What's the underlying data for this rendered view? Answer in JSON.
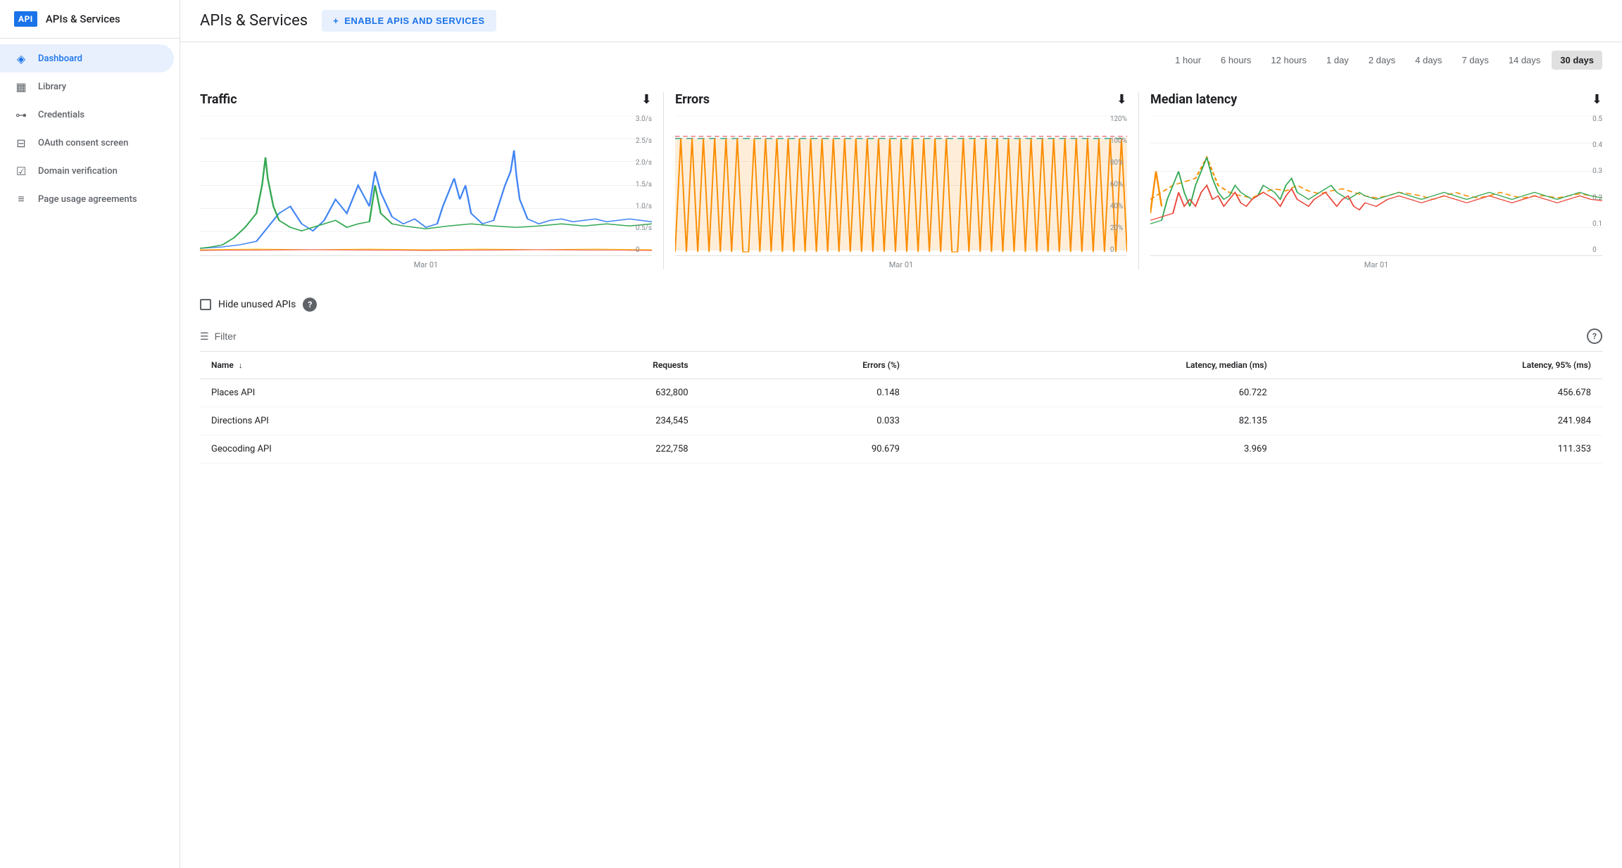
{
  "sidebar": {
    "logo_text": "API",
    "title": "APIs & Services",
    "items": [
      {
        "id": "dashboard",
        "label": "Dashboard",
        "icon": "◈",
        "active": true
      },
      {
        "id": "library",
        "label": "Library",
        "icon": "▦",
        "active": false
      },
      {
        "id": "credentials",
        "label": "Credentials",
        "icon": "⊶",
        "active": false
      },
      {
        "id": "oauth",
        "label": "OAuth consent screen",
        "icon": "⊟",
        "active": false
      },
      {
        "id": "domain",
        "label": "Domain verification",
        "icon": "☑",
        "active": false
      },
      {
        "id": "page-usage",
        "label": "Page usage agreements",
        "icon": "≡",
        "active": false
      }
    ]
  },
  "header": {
    "title": "APIs & Services",
    "enable_button": "ENABLE APIS AND SERVICES",
    "enable_plus": "+"
  },
  "time_range": {
    "options": [
      {
        "id": "1h",
        "label": "1 hour",
        "active": false
      },
      {
        "id": "6h",
        "label": "6 hours",
        "active": false
      },
      {
        "id": "12h",
        "label": "12 hours",
        "active": false
      },
      {
        "id": "1d",
        "label": "1 day",
        "active": false
      },
      {
        "id": "2d",
        "label": "2 days",
        "active": false
      },
      {
        "id": "4d",
        "label": "4 days",
        "active": false
      },
      {
        "id": "7d",
        "label": "7 days",
        "active": false
      },
      {
        "id": "14d",
        "label": "14 days",
        "active": false
      },
      {
        "id": "30d",
        "label": "30 days",
        "active": true
      }
    ]
  },
  "charts": {
    "traffic": {
      "title": "Traffic",
      "x_label": "Mar 01",
      "y_labels": [
        "3.0/s",
        "2.5/s",
        "2.0/s",
        "1.5/s",
        "1.0/s",
        "0.5/s",
        "0"
      ]
    },
    "errors": {
      "title": "Errors",
      "x_label": "Mar 01",
      "y_labels": [
        "120%",
        "100%",
        "80%",
        "60%",
        "40%",
        "20%",
        "0"
      ]
    },
    "latency": {
      "title": "Median latency",
      "x_label": "Mar 01",
      "y_labels": [
        "0.5",
        "0.4",
        "0.3",
        "0.2",
        "0.1",
        "0"
      ]
    }
  },
  "filter": {
    "label": "Filter",
    "help_label": "?"
  },
  "hide_unused": {
    "label": "Hide unused APIs",
    "help": "?"
  },
  "table": {
    "columns": [
      {
        "id": "name",
        "label": "Name",
        "sort": true
      },
      {
        "id": "requests",
        "label": "Requests",
        "sort": false
      },
      {
        "id": "errors",
        "label": "Errors (%)",
        "sort": false
      },
      {
        "id": "latency_median",
        "label": "Latency, median (ms)",
        "sort": false
      },
      {
        "id": "latency_95",
        "label": "Latency, 95% (ms)",
        "sort": false
      }
    ],
    "rows": [
      {
        "name": "Places API",
        "requests": "632,800",
        "errors": "0.148",
        "latency_median": "60.722",
        "latency_95": "456.678"
      },
      {
        "name": "Directions API",
        "requests": "234,545",
        "errors": "0.033",
        "latency_median": "82.135",
        "latency_95": "241.984"
      },
      {
        "name": "Geocoding API",
        "requests": "222,758",
        "errors": "90.679",
        "latency_median": "3.969",
        "latency_95": "111.353"
      }
    ]
  }
}
